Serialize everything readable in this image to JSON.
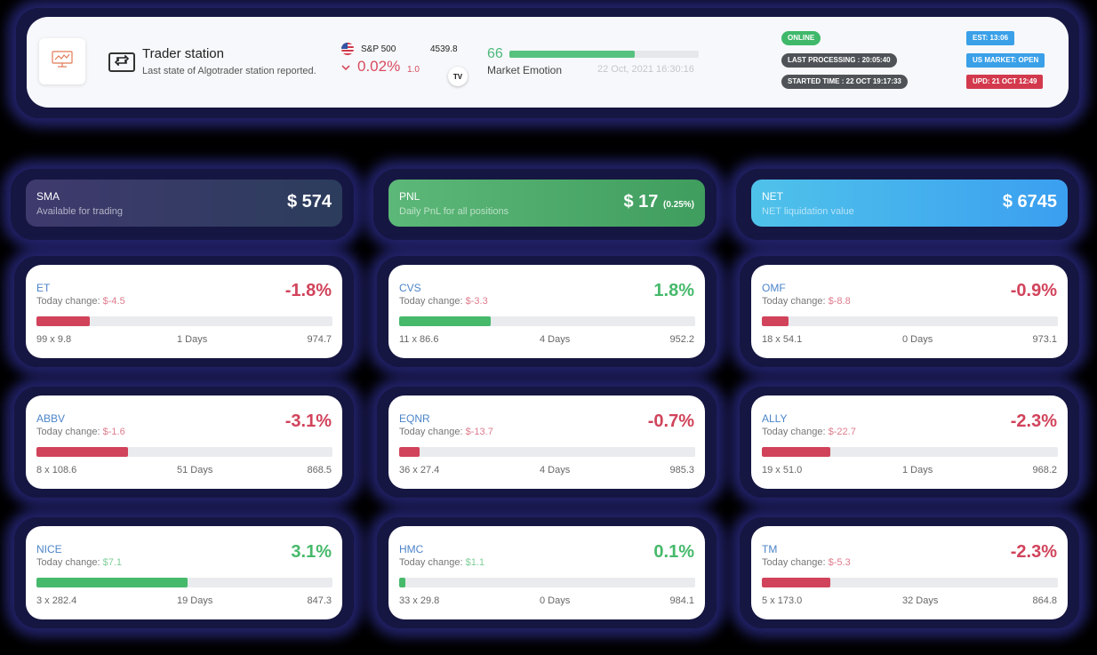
{
  "header": {
    "title": "Trader station",
    "subtitle": "Last state of Algotrader station reported.",
    "index": {
      "name": "S&P 500",
      "value": "4539.8",
      "pct": "0.02%",
      "change": "1.0"
    },
    "tv_badge": "TV",
    "emotion": {
      "value": "66",
      "label": "Market Emotion",
      "date": "22 Oct, 2021 16:30:16",
      "level": 0.66
    },
    "status": {
      "online": "ONLINE",
      "last_processing": "LAST PROCESSING : 20:05:40",
      "started_time": "STARTED TIME : 22 OCT 19:17:33"
    },
    "tags": {
      "est": "EST: 13:06",
      "market": "US MARKET: OPEN",
      "upd": "UPD: 21 OCT 12:49"
    }
  },
  "summary": {
    "sma": {
      "label": "SMA",
      "desc": "Available for trading",
      "value": "$ 574"
    },
    "pnl": {
      "label": "PNL",
      "desc": "Daily PnL for all positions",
      "value": "$ 17",
      "pct": "(0.25%)"
    },
    "net": {
      "label": "NET",
      "desc": "NET liquidation value",
      "value": "$ 6745"
    }
  },
  "stocks": [
    {
      "ticker": "ET",
      "change_label": "Today change:",
      "change": "$-4.5",
      "pct": "-1.8%",
      "size": "99 x 9.8",
      "days": "1 Days",
      "price": "974.7",
      "fill": 0.18,
      "positive": false
    },
    {
      "ticker": "CVS",
      "change_label": "Today change:",
      "change": "$-3.3",
      "pct": "1.8%",
      "size": "11 x 86.6",
      "days": "4 Days",
      "price": "952.2",
      "fill": 0.31,
      "positive": true
    },
    {
      "ticker": "OMF",
      "change_label": "Today change:",
      "change": "$-8.8",
      "pct": "-0.9%",
      "size": "18 x 54.1",
      "days": "0 Days",
      "price": "973.1",
      "fill": 0.09,
      "positive": false
    },
    {
      "ticker": "ABBV",
      "change_label": "Today change:",
      "change": "$-1.6",
      "pct": "-3.1%",
      "size": "8 x 108.6",
      "days": "51 Days",
      "price": "868.5",
      "fill": 0.31,
      "positive": false
    },
    {
      "ticker": "EQNR",
      "change_label": "Today change:",
      "change": "$-13.7",
      "pct": "-0.7%",
      "size": "36 x 27.4",
      "days": "4 Days",
      "price": "985.3",
      "fill": 0.07,
      "positive": false
    },
    {
      "ticker": "ALLY",
      "change_label": "Today change:",
      "change": "$-22.7",
      "pct": "-2.3%",
      "size": "19 x 51.0",
      "days": "1 Days",
      "price": "968.2",
      "fill": 0.23,
      "positive": false
    },
    {
      "ticker": "NICE",
      "change_label": "Today change:",
      "change": "$7.1",
      "pct": "3.1%",
      "size": "3 x 282.4",
      "days": "19 Days",
      "price": "847.3",
      "fill": 0.51,
      "positive": true
    },
    {
      "ticker": "HMC",
      "change_label": "Today change:",
      "change": "$1.1",
      "pct": "0.1%",
      "size": "33 x 29.8",
      "days": "0 Days",
      "price": "984.1",
      "fill": 0.02,
      "positive": true
    },
    {
      "ticker": "TM",
      "change_label": "Today change:",
      "change": "$-5.3",
      "pct": "-2.3%",
      "size": "5 x 173.0",
      "days": "32 Days",
      "price": "864.8",
      "fill": 0.23,
      "positive": false
    }
  ],
  "colors": {
    "positive": "#46b96b",
    "negative": "#d1435b",
    "ticker": "#4c84c9",
    "online": "#3fb86a",
    "status_dark": "#4f5357",
    "tag_blue": "#3aa0e8",
    "tag_red": "#d3394d"
  }
}
